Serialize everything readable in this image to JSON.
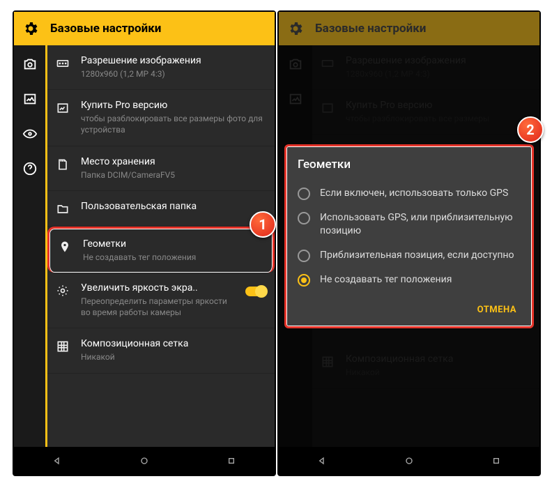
{
  "header": {
    "title": "Базовые настройки"
  },
  "items": {
    "resolution": {
      "title": "Разрешение изображения",
      "sub": "1280x960 (1,2 МР 4:3)"
    },
    "pro": {
      "title": "Купить Pro версию",
      "sub": "чтобы разблокировать все размеры фото для устройства"
    },
    "storage": {
      "title": "Место хранения",
      "sub": "Папка DCIM/CameraFV5"
    },
    "folder": {
      "title": "Пользовательская папка"
    },
    "geotag": {
      "title": "Геометки",
      "sub": "Не создавать тег положения"
    },
    "brightness": {
      "title": "Увеличить яркость экра..",
      "sub": "Переопределить параметры яркости во время работы камеры"
    },
    "grid": {
      "title": "Композиционная сетка",
      "sub": "Никакой"
    }
  },
  "dialog": {
    "title": "Геометки",
    "opt1": "Если включен, использовать только GPS",
    "opt2": "Использовать GPS, или приблизительную позицию",
    "opt3": "Приблизительная позиция, если доступно",
    "opt4": "Не создавать тег положения",
    "cancel": "ОТМЕНА"
  },
  "badges": {
    "one": "1",
    "two": "2"
  }
}
